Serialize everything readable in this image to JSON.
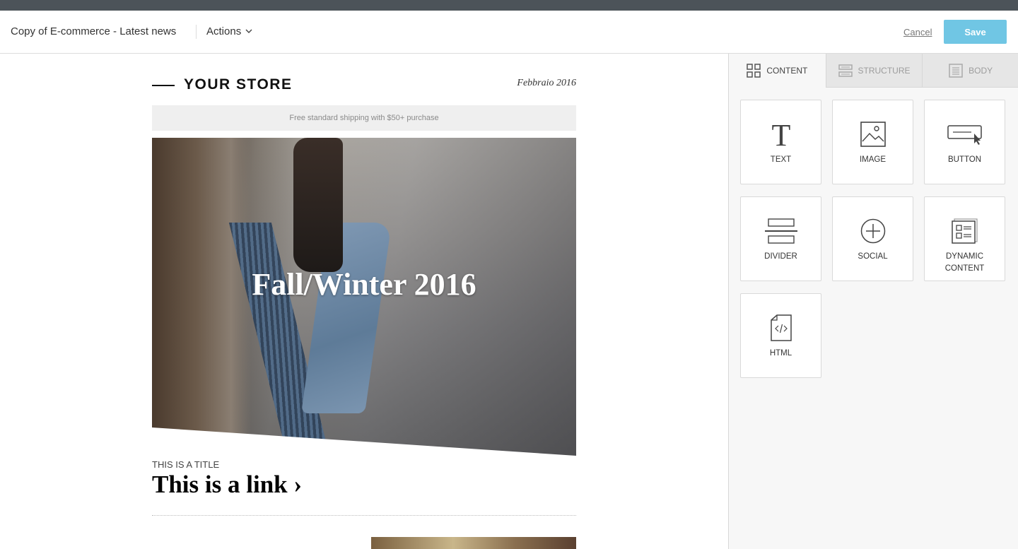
{
  "header": {
    "doc_title": "Copy of E-commerce - Latest news",
    "actions_label": "Actions",
    "cancel_label": "Cancel",
    "save_label": "Save"
  },
  "email": {
    "store_name": "YOUR STORE",
    "date": "Febbraio 2016",
    "shipping_banner": "Free standard shipping with $50+ purchase",
    "hero_title": "Fall/Winter 2016",
    "kicker": "THIS IS A TITLE",
    "link_title": "This is a link ›"
  },
  "panel": {
    "tabs": [
      {
        "label": "CONTENT",
        "icon": "grid-icon",
        "active": true
      },
      {
        "label": "STRUCTURE",
        "icon": "rows-icon",
        "active": false
      },
      {
        "label": "BODY",
        "icon": "document-icon",
        "active": false
      }
    ],
    "tiles": [
      {
        "label": "TEXT",
        "icon": "text-icon"
      },
      {
        "label": "IMAGE",
        "icon": "image-icon"
      },
      {
        "label": "BUTTON",
        "icon": "button-icon"
      },
      {
        "label": "DIVIDER",
        "icon": "divider-icon"
      },
      {
        "label": "SOCIAL",
        "icon": "social-plus-icon"
      },
      {
        "label": "DYNAMIC CONTENT",
        "icon": "dynamic-content-icon"
      },
      {
        "label": "HTML",
        "icon": "html-file-icon"
      }
    ]
  },
  "colors": {
    "top_strip": "#4c5359",
    "save_button": "#70c6e4",
    "panel_bg": "#f7f7f7"
  }
}
